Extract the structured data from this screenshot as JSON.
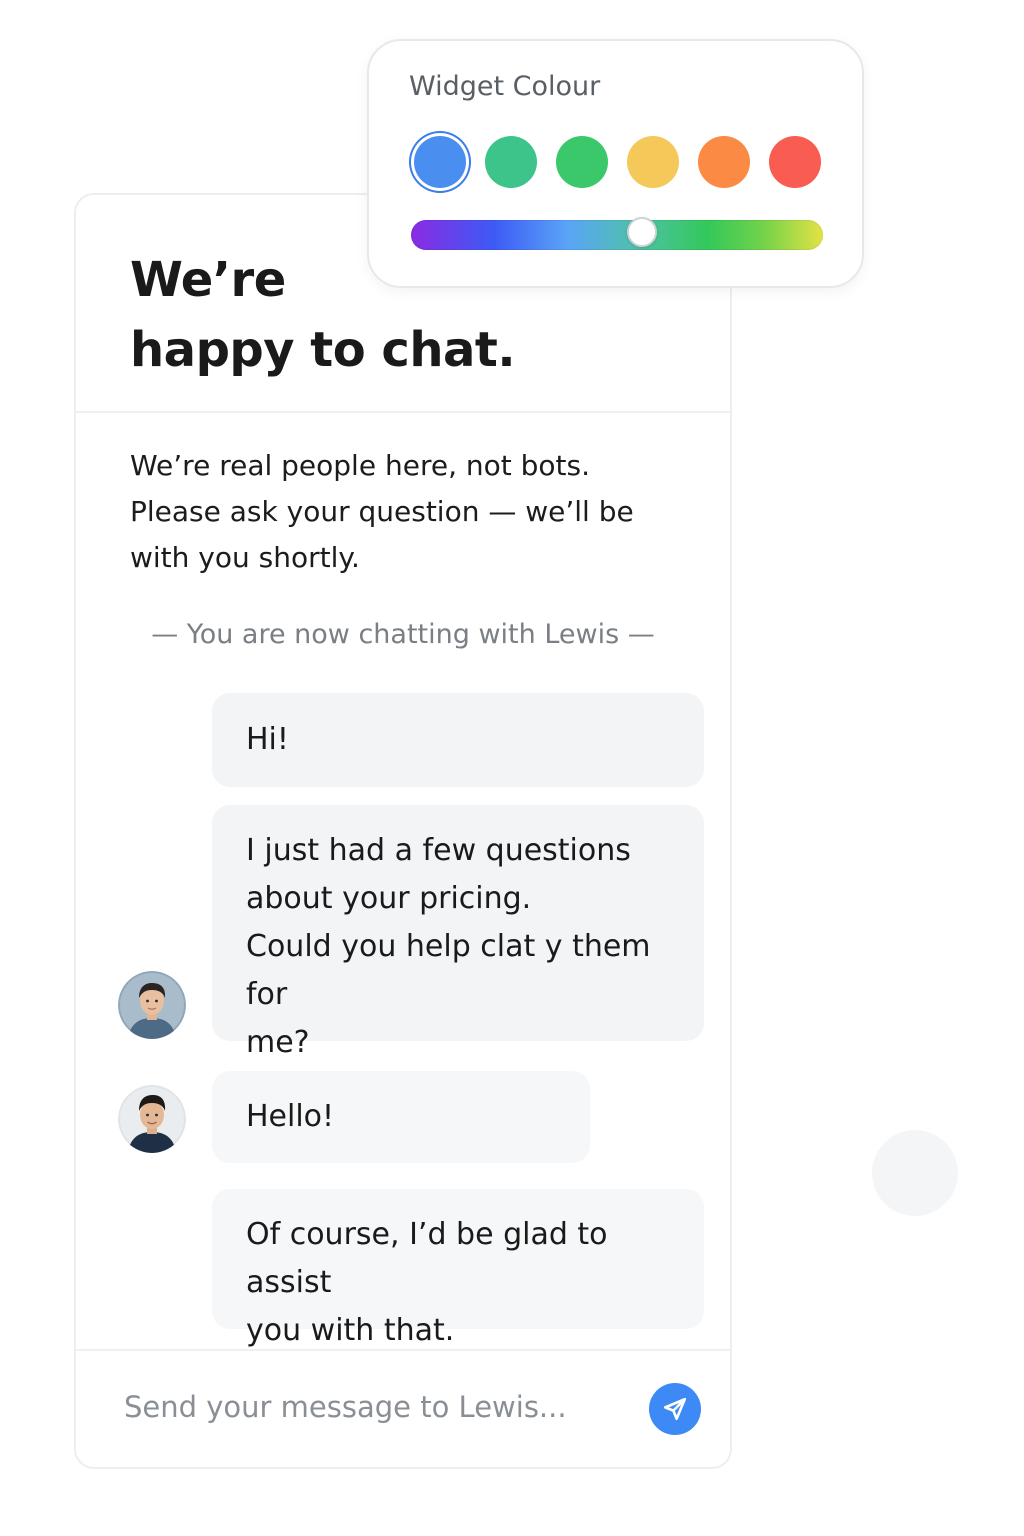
{
  "widget": {
    "title": "Widget Colour",
    "swatches": [
      {
        "name": "blue",
        "color": "#4a8ff0",
        "selected": true
      },
      {
        "name": "teal",
        "color": "#3cc48a",
        "selected": false
      },
      {
        "name": "green",
        "color": "#3bc86a",
        "selected": false
      },
      {
        "name": "yellow",
        "color": "#f5c85a",
        "selected": false
      },
      {
        "name": "orange",
        "color": "#fb8a44",
        "selected": false
      },
      {
        "name": "red",
        "color": "#f95c50",
        "selected": false
      }
    ],
    "hue_position": 0.56
  },
  "chat": {
    "title_line1": "We’re",
    "title_line2": "happy to chat.",
    "intro_lines": [
      "We’re real people here, not bots.",
      "Please ask your question — we’ll be",
      "with you shortly."
    ],
    "status": "— You are now chatting with Lewis —",
    "messages": [
      {
        "lines": [
          "Hi!"
        ]
      },
      {
        "lines": [
          "I just had a few questions",
          "about your pricing.",
          "Could you help clat y them for",
          "me?"
        ]
      },
      {
        "lines": [
          "Hello!"
        ]
      },
      {
        "lines": [
          "Of course, I’d be glad to assist",
          "you with that."
        ]
      }
    ],
    "composer": {
      "placeholder": "Send your message to Lewis...",
      "send_icon": "send-icon"
    }
  },
  "colors": {
    "accent": "#3d8af7",
    "bubble_bg": "#f3f4f6"
  }
}
